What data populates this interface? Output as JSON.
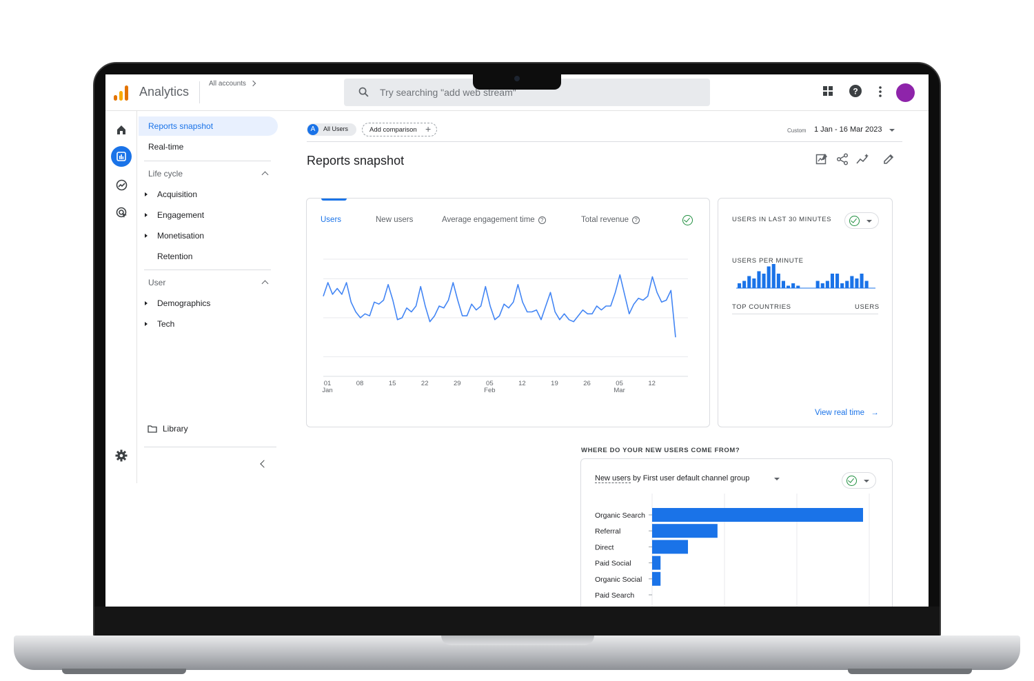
{
  "app": {
    "title": "Analytics",
    "accounts": "All accounts"
  },
  "search": {
    "placeholder": "Try searching \"add web stream\""
  },
  "colors": {
    "accent": "#1a73e8",
    "avatar": "#8e24aa",
    "success": "#1e8e3e"
  },
  "topbar_icons": [
    "apps-grid-icon",
    "help-icon",
    "more-vert-icon"
  ],
  "rail": [
    "home-icon",
    "reports-icon",
    "explore-icon",
    "advertising-icon",
    "settings-icon"
  ],
  "nav": {
    "reports_snapshot": "Reports snapshot",
    "realtime": "Real-time",
    "lifecycle": {
      "label": "Life cycle",
      "items": [
        "Acquisition",
        "Engagement",
        "Monetisation",
        "Retention"
      ]
    },
    "user": {
      "label": "User",
      "items": [
        "Demographics",
        "Tech"
      ]
    },
    "library": "Library"
  },
  "comparison": {
    "segment_letter": "A",
    "segment": "All Users",
    "add": "Add comparison"
  },
  "date": {
    "custom": "Custom",
    "range": "1 Jan - 16 Mar 2023"
  },
  "page_title": "Reports snapshot",
  "metrics_card": {
    "tabs": [
      "Users",
      "New users",
      "Average engagement time",
      "Total revenue"
    ],
    "active_tab": 0
  },
  "realtime_card": {
    "title": "USERS IN LAST 30 MINUTES",
    "per_minute": "USERS PER MINUTE",
    "countries_header": "TOP COUNTRIES",
    "users_header": "USERS",
    "link": "View real time"
  },
  "channel_section": {
    "heading": "WHERE DO YOUR NEW USERS COME FROM?",
    "selector_metric": "New users",
    "selector_dimension": " by First user default channel group"
  },
  "chart_data": [
    {
      "type": "line",
      "x_ticks": [
        {
          "day": "01",
          "month": "Jan"
        },
        {
          "day": "08",
          "month": ""
        },
        {
          "day": "15",
          "month": ""
        },
        {
          "day": "22",
          "month": ""
        },
        {
          "day": "29",
          "month": ""
        },
        {
          "day": "05",
          "month": "Feb"
        },
        {
          "day": "12",
          "month": ""
        },
        {
          "day": "19",
          "month": ""
        },
        {
          "day": "26",
          "month": ""
        },
        {
          "day": "05",
          "month": "Mar"
        },
        {
          "day": "12",
          "month": ""
        }
      ],
      "series": [
        {
          "values": [
            6.1,
            6.8,
            6.2,
            6.5,
            6.2,
            6.8,
            5.8,
            5.3,
            5.0,
            5.2,
            5.1,
            5.8,
            5.7,
            5.9,
            6.7,
            5.9,
            4.9,
            5.0,
            5.5,
            5.3,
            5.6,
            6.6,
            5.6,
            4.8,
            5.1,
            5.6,
            5.5,
            5.9,
            6.8,
            5.9,
            5.1,
            5.1,
            5.7,
            5.4,
            5.6,
            6.6,
            5.6,
            4.9,
            5.1,
            5.7,
            5.5,
            5.8,
            6.7,
            5.8,
            5.3,
            5.3,
            5.4,
            4.9,
            5.6,
            6.3,
            5.3,
            4.9,
            5.2,
            4.9,
            4.8,
            5.1,
            5.4,
            5.2,
            5.2,
            5.6,
            5.4,
            5.6,
            5.6,
            6.3,
            7.2,
            6.2,
            5.2,
            5.7,
            6.0,
            5.9,
            6.1,
            7.1,
            6.3,
            5.8,
            5.9,
            6.4,
            4.0
          ]
        }
      ]
    },
    {
      "type": "bar",
      "values": [
        2,
        3,
        5,
        4,
        7,
        6,
        9,
        10,
        6,
        3,
        1,
        2,
        1,
        0,
        0,
        0,
        3,
        2,
        3,
        6,
        6,
        2,
        3,
        5,
        4,
        6,
        3
      ]
    },
    {
      "type": "bar",
      "orientation": "horizontal",
      "categories": [
        "Organic Search",
        "Referral",
        "Direct",
        "Paid Social",
        "Organic Social",
        "Paid Search"
      ],
      "values": [
        100,
        31,
        17,
        4,
        4,
        0
      ]
    }
  ]
}
